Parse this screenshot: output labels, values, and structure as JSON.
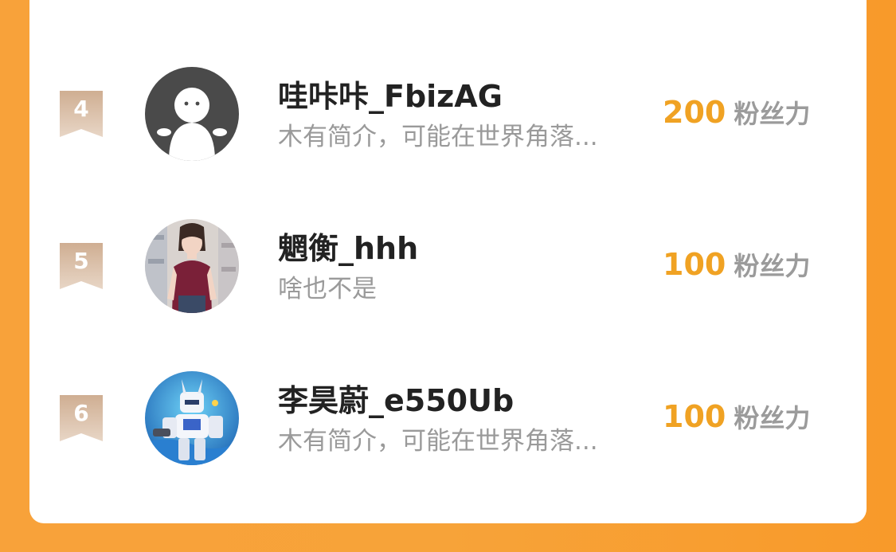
{
  "ranking": {
    "rows": [
      {
        "rank": "4",
        "name": "哇咔咔_FbizAG",
        "bio": "木有简介，可能在世界角落...",
        "score": "200",
        "unit": "粉丝力",
        "avatar": "default-avatar-icon"
      },
      {
        "rank": "5",
        "name": "魍衡_hhh",
        "bio": "啥也不是",
        "score": "100",
        "unit": "粉丝力",
        "avatar": "anime-girl-avatar"
      },
      {
        "rank": "6",
        "name": "李昊蔚_e550Ub",
        "bio": "木有简介，可能在世界角落...",
        "score": "100",
        "unit": "粉丝力",
        "avatar": "robot-mecha-avatar"
      }
    ]
  },
  "colors": {
    "background": "#f8a23a",
    "score": "#f0a223",
    "rank_ribbon": "#d9bfa7",
    "name": "#222222",
    "bio": "#9a9a9a"
  }
}
